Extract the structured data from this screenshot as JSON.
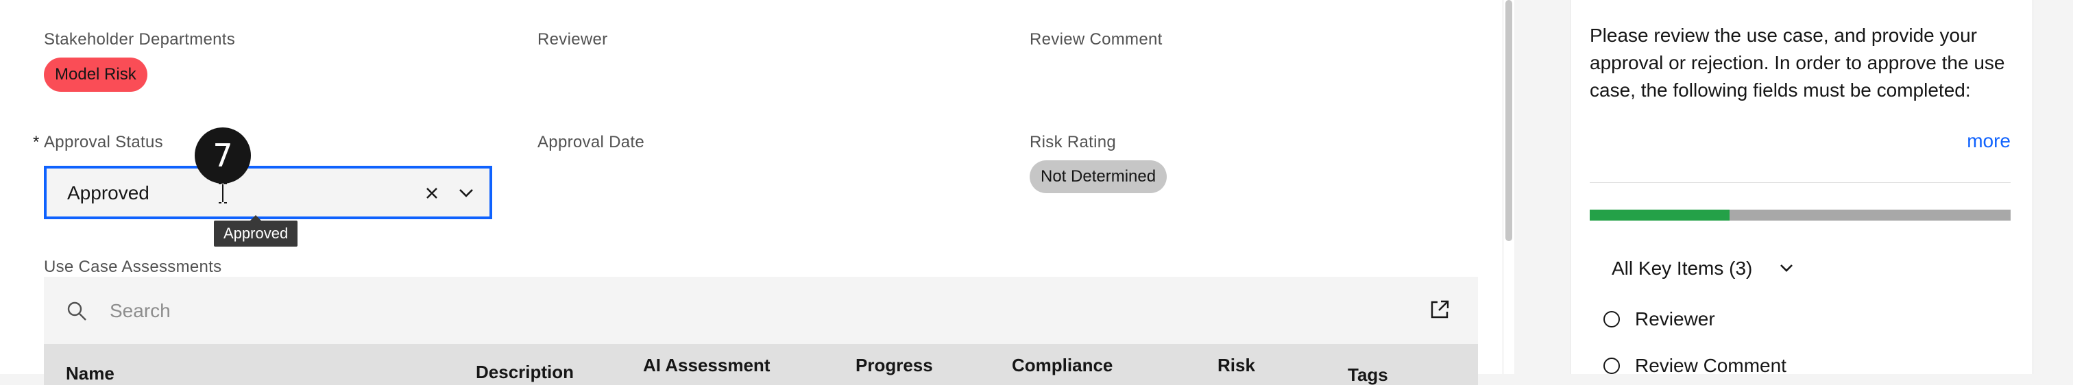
{
  "form": {
    "stakeholder_label": "Stakeholder Departments",
    "stakeholder_tag": "Model Risk",
    "reviewer_label": "Reviewer",
    "review_comment_label": "Review Comment",
    "approval_status_required": "*",
    "approval_status_label": "Approval Status",
    "approval_status_value": "Approved",
    "approval_date_label": "Approval Date",
    "risk_rating_label": "Risk Rating",
    "risk_rating_value": "Not Determined",
    "step_badge": "7",
    "tooltip": "Approved"
  },
  "assessments": {
    "label": "Use Case Assessments",
    "search_placeholder": "Search",
    "columns": [
      "Name",
      "Description",
      "AI Assessment",
      "Progress",
      "Compliance",
      "Risk",
      "Tags"
    ]
  },
  "side_panel": {
    "description": "Please review the use case, and provide your approval or rejection. In order to approve the use case, the following fields must be completed:",
    "more_link": "more",
    "progress_fraction": 0.333,
    "key_items_label": "All Key Items (3)",
    "items": [
      "Reviewer",
      "Review Comment"
    ]
  },
  "colors": {
    "accent": "#0f62fe",
    "tag_red": "#fa4d56",
    "tag_gray": "#c6c6c6",
    "progress_done": "#24a148"
  },
  "icons": [
    "search-icon",
    "launch-icon",
    "close-icon",
    "chevron-down-icon",
    "text-cursor-icon"
  ]
}
